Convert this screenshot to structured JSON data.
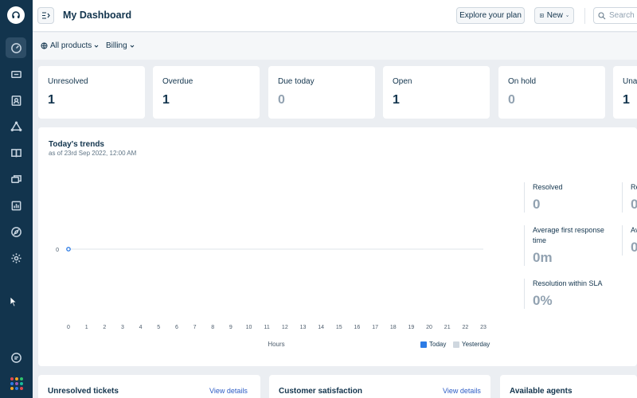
{
  "topbar": {
    "title": "My Dashboard",
    "explore_label": "Explore your plan",
    "new_label": "New",
    "search_placeholder": "Search"
  },
  "filters": {
    "products": "All products",
    "billing": "Billing"
  },
  "stats": [
    {
      "label": "Unresolved",
      "value": "1",
      "zero": false
    },
    {
      "label": "Overdue",
      "value": "1",
      "zero": false
    },
    {
      "label": "Due today",
      "value": "0",
      "zero": true
    },
    {
      "label": "Open",
      "value": "1",
      "zero": false
    },
    {
      "label": "On hold",
      "value": "0",
      "zero": true
    },
    {
      "label": "Una",
      "value": "1",
      "zero": false
    }
  ],
  "trends": {
    "title": "Today's trends",
    "subtitle": "as of 23rd Sep 2022, 12:00 AM",
    "xlabel": "Hours",
    "legend_today": "Today",
    "legend_yesterday": "Yesterday"
  },
  "metrics": {
    "resolved_label": "Resolved",
    "resolved_value": "0",
    "resolved_cut_label": "Re",
    "resolved_cut_value": "0",
    "afrt_label": "Average first response time",
    "afrt_value": "0m",
    "afrt_cut_label": "Av",
    "afrt_cut_value": "0",
    "sla_label": "Resolution within SLA",
    "sla_value": "0%"
  },
  "bottom": {
    "unresolved_title": "Unresolved tickets",
    "unresolved_link": "View details",
    "csat_title": "Customer satisfaction",
    "csat_link": "View details",
    "agents_title": "Available agents"
  },
  "colors": {
    "sidebar": "#12344d",
    "today": "#2c7be5",
    "yesterday": "#cfd7df"
  },
  "chart_data": {
    "type": "line",
    "x": [
      0,
      1,
      2,
      3,
      4,
      5,
      6,
      7,
      8,
      9,
      10,
      11,
      12,
      13,
      14,
      15,
      16,
      17,
      18,
      19,
      20,
      21,
      22,
      23
    ],
    "xlabel": "Hours",
    "ylabel": "",
    "yticks": [
      0
    ],
    "series": [
      {
        "name": "Today",
        "values": [
          0
        ]
      },
      {
        "name": "Yesterday",
        "values": []
      }
    ],
    "legend": "bottom-right",
    "grid": false
  },
  "sidebar": {
    "icons": [
      "dashboard-icon",
      "tickets-icon",
      "contacts-icon",
      "groups-icon",
      "knowledge-base-icon",
      "conversations-icon",
      "reports-icon",
      "discover-icon",
      "settings-icon",
      "chat-icon",
      "apps-icon"
    ]
  }
}
